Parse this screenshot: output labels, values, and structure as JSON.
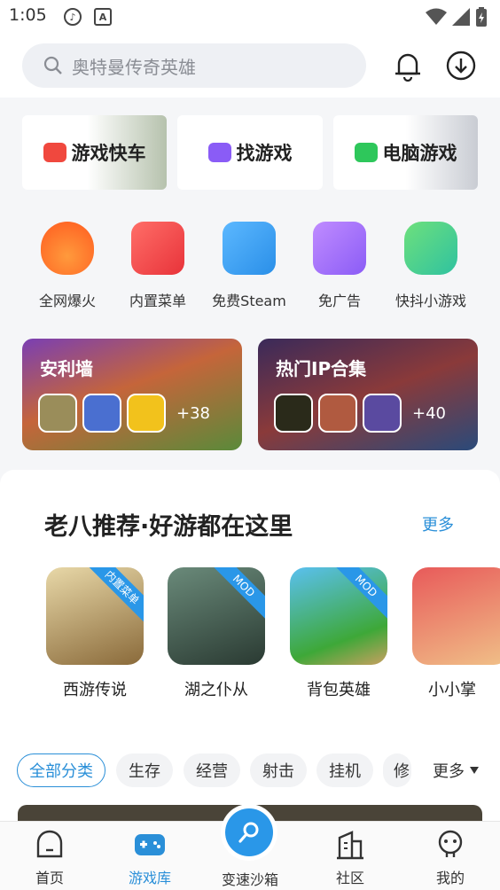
{
  "status": {
    "time": "1:05",
    "ic1": "♪",
    "ic2": "A"
  },
  "search": {
    "placeholder": "奥特曼传奇英雄"
  },
  "banners": [
    {
      "label": "游戏快车",
      "color": "#f0483e"
    },
    {
      "label": "找游戏",
      "color": "#8a5cf6"
    },
    {
      "label": "电脑游戏",
      "color": "#2ec75b"
    }
  ],
  "quick": [
    {
      "label": "全网爆火",
      "icon": "fire-icon"
    },
    {
      "label": "内置菜单",
      "icon": "menu-icon"
    },
    {
      "label": "免费Steam",
      "icon": "monitor-icon"
    },
    {
      "label": "免广告",
      "icon": "no-ads-icon"
    },
    {
      "label": "快抖小游戏",
      "icon": "gamepad-icon"
    }
  ],
  "cards": [
    {
      "title": "安利墙",
      "more": "+38"
    },
    {
      "title": "热门IP合集",
      "more": "+40"
    }
  ],
  "recommend": {
    "title": "老八推荐·好游都在这里",
    "more": "更多",
    "games": [
      {
        "name": "西游传说",
        "badge": "内置菜单"
      },
      {
        "name": "湖之仆从",
        "badge": "MOD"
      },
      {
        "name": "背包英雄",
        "badge": "MOD"
      },
      {
        "name": "小小掌",
        "badge": ""
      }
    ]
  },
  "categories": {
    "items": [
      "全部分类",
      "生存",
      "经营",
      "射击",
      "挂机",
      "修"
    ],
    "more": "更多"
  },
  "tabs": [
    {
      "label": "首页"
    },
    {
      "label": "游戏库"
    },
    {
      "label": "变速沙箱"
    },
    {
      "label": "社区"
    },
    {
      "label": "我的"
    }
  ]
}
